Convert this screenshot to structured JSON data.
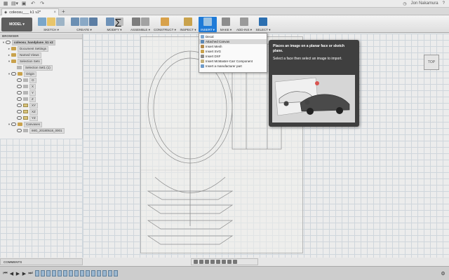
{
  "titlebar": {
    "user": "Jon Nakamura"
  },
  "tab": {
    "title": "coleosu___ k1 v2*"
  },
  "workspace": {
    "label": "MODEL ▾"
  },
  "toolbar": {
    "groups": [
      {
        "label": "SKETCH ▾"
      },
      {
        "label": "CREATE ▾"
      },
      {
        "label": "MODIFY ▾"
      },
      {
        "label": "ASSEMBLE ▾"
      },
      {
        "label": "CONSTRUCT ▾"
      },
      {
        "label": "INSPECT ▾"
      },
      {
        "label": "INSERT ▾"
      },
      {
        "label": "MAKE ▾"
      },
      {
        "label": "ADD-INS ▾"
      },
      {
        "label": "SELECT ▾"
      }
    ]
  },
  "browser": {
    "title": "BROWSER",
    "items": [
      {
        "label": "coleosu_handplane_k1 v2"
      },
      {
        "label": "Document Settings"
      },
      {
        "label": "Named Views"
      },
      {
        "label": "Selection Sets"
      },
      {
        "label": "Selection Set1 (1)"
      },
      {
        "label": "Origin"
      },
      {
        "label": "O"
      },
      {
        "label": "X"
      },
      {
        "label": "Y"
      },
      {
        "label": "Z"
      },
      {
        "label": "XY"
      },
      {
        "label": "XZ"
      },
      {
        "label": "YZ"
      },
      {
        "label": "Canvases"
      },
      {
        "label": "IMG_20180518_0001"
      }
    ]
  },
  "insert_menu": {
    "items": [
      {
        "label": "Decal"
      },
      {
        "label": "Attached Canvas"
      },
      {
        "label": "Insert Mesh"
      },
      {
        "label": "Insert SVG"
      },
      {
        "label": "Insert DXF"
      },
      {
        "label": "Insert McMaster-Carr Component"
      },
      {
        "label": "Insert a manufacturer part"
      }
    ]
  },
  "tooltip": {
    "line1": "Places an image on a planar face or sketch plane.",
    "line2": "Select a face then select an image to import."
  },
  "viewcube": {
    "label": "TOP"
  },
  "comments": {
    "label": "COMMENTS"
  },
  "colors": {
    "accent": "#1f7bd8",
    "tooltip_bg": "#3f3f3f"
  }
}
